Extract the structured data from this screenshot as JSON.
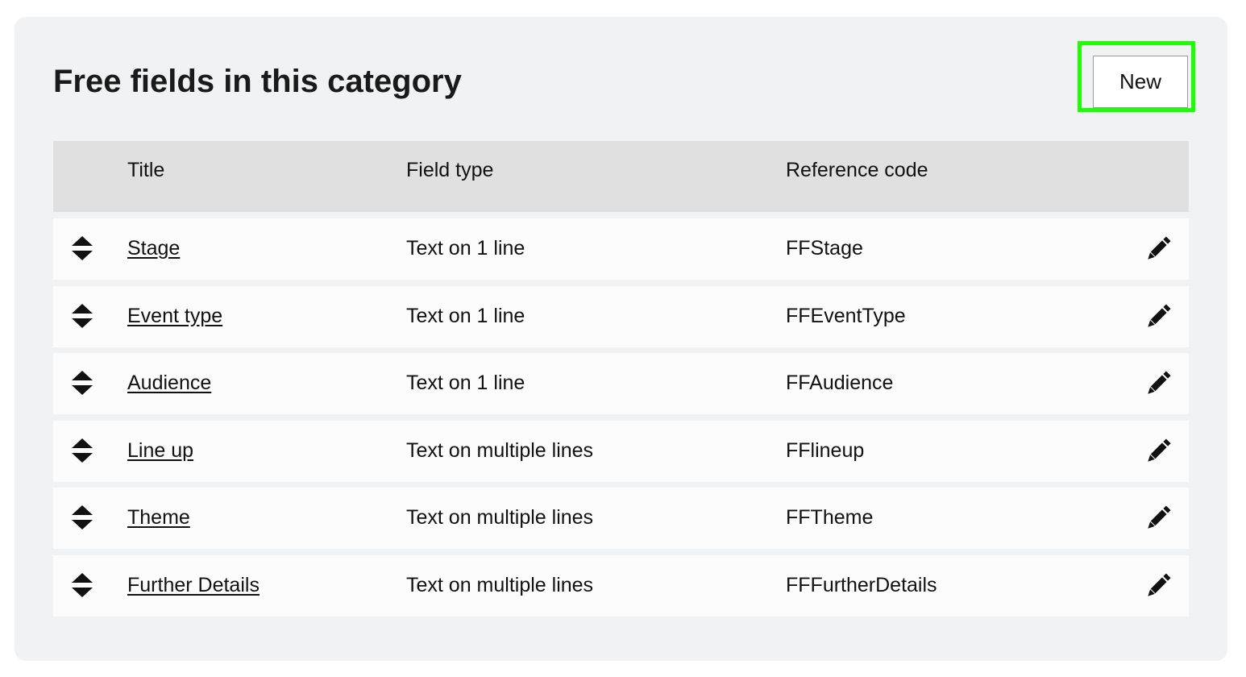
{
  "header": {
    "title": "Free fields in this category",
    "new_button_label": "New"
  },
  "table": {
    "columns": [
      "Title",
      "Field type",
      "Reference code"
    ],
    "rows": [
      {
        "title": "Stage",
        "field_type": "Text on 1 line",
        "reference_code": "FFStage"
      },
      {
        "title": "Event type",
        "field_type": "Text on 1 line",
        "reference_code": "FFEventType"
      },
      {
        "title": "Audience",
        "field_type": "Text on 1 line",
        "reference_code": "FFAudience"
      },
      {
        "title": "Line up",
        "field_type": "Text on multiple lines",
        "reference_code": "FFlineup"
      },
      {
        "title": "Theme",
        "field_type": "Text on multiple lines",
        "reference_code": "FFTheme"
      },
      {
        "title": "Further Details",
        "field_type": "Text on multiple lines",
        "reference_code": "FFFurtherDetails"
      }
    ]
  },
  "icons": {
    "reorder": "sort-icon",
    "edit": "pencil-icon"
  },
  "colors": {
    "panel_background": "#f1f2f3",
    "header_background": "#dfe0df",
    "row_background": "#fcfcfc",
    "highlight": "#1cff00"
  }
}
